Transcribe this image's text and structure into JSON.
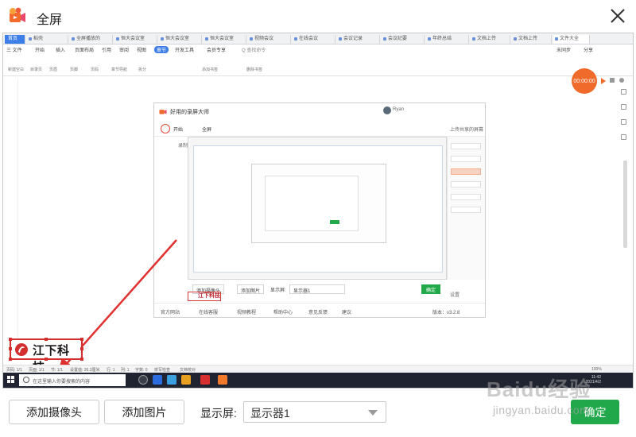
{
  "dialog": {
    "title": "全屏",
    "close_label": "×"
  },
  "bottom": {
    "add_camera": "添加摄像头",
    "add_image": "添加图片",
    "display_label": "显示屏:",
    "display_value": "显示器1",
    "ok": "确定"
  },
  "watermark": {
    "main": "Baidu经验",
    "sub": "jingyan.baidu.com"
  },
  "screen": {
    "tabs": [
      {
        "label": "首页"
      },
      {
        "label": "稻壳"
      },
      {
        "label": "全屏播放的"
      },
      {
        "label": "恒大会议室"
      },
      {
        "label": "恒大会议室"
      },
      {
        "label": "恒大会议室"
      },
      {
        "label": "视频会议"
      },
      {
        "label": "在线会议"
      },
      {
        "label": "会议记录"
      },
      {
        "label": "会议纪要"
      },
      {
        "label": "年终总结"
      },
      {
        "label": "文档上传"
      },
      {
        "label": "文档上传"
      },
      {
        "label": "文件大全"
      }
    ],
    "menu": [
      "三 文件",
      "开始",
      "插入",
      "页面布局",
      "引用",
      "审阅",
      "视图",
      "章节",
      "开发工具",
      "会员专享"
    ],
    "menu_active": "章节",
    "search_hint": "Q 查找命令",
    "user_hint": "未同步",
    "share": "分享",
    "ribbon": [
      "新建空白",
      "目录页",
      "页眉",
      "页脚",
      "页码",
      "章节导航",
      "拆分",
      "添加书签",
      "删除书签"
    ],
    "rec_time": "00:00:00",
    "nested": {
      "title": "好用的录屏大师",
      "user": "Ryan",
      "toolbar_start": "开始",
      "toolbar_screen": "全屏",
      "toolbar_right": "上传共享的屏幕",
      "side_label": "录制模式",
      "bottom": {
        "add_camera": "添加摄像头",
        "add_image": "添加图片",
        "display_label": "显示屏:",
        "display_value": "显示器1",
        "ok": "确定"
      },
      "footer": [
        "官方网站",
        "在线客服",
        "视频教程",
        "帮助中心",
        "意见反馈",
        "建议"
      ],
      "version": "版本：v3.2.8",
      "setting": "设置"
    },
    "logo_text": "江下科技",
    "mini_logo_text": "江下科技",
    "status": [
      "页码: 1/1",
      "页面: 1/1",
      "节: 1/1",
      "设置值: 26.3厘米",
      "行: 1",
      "列: 1",
      "字数: 0",
      "拼写检查",
      "文档校对"
    ],
    "zoom": "100%",
    "taskbar": {
      "search_placeholder": "在这里输入你要搜索的内容",
      "time": "11:42",
      "date": "2021/4/2"
    }
  },
  "colors": {
    "accent_green": "#20a84a",
    "arrow_red": "#e03030",
    "record_orange": "#f06a2b"
  },
  "icons": [
    "video-camera-icon",
    "close-icon",
    "chevron-down-icon",
    "arrow-pointer"
  ]
}
